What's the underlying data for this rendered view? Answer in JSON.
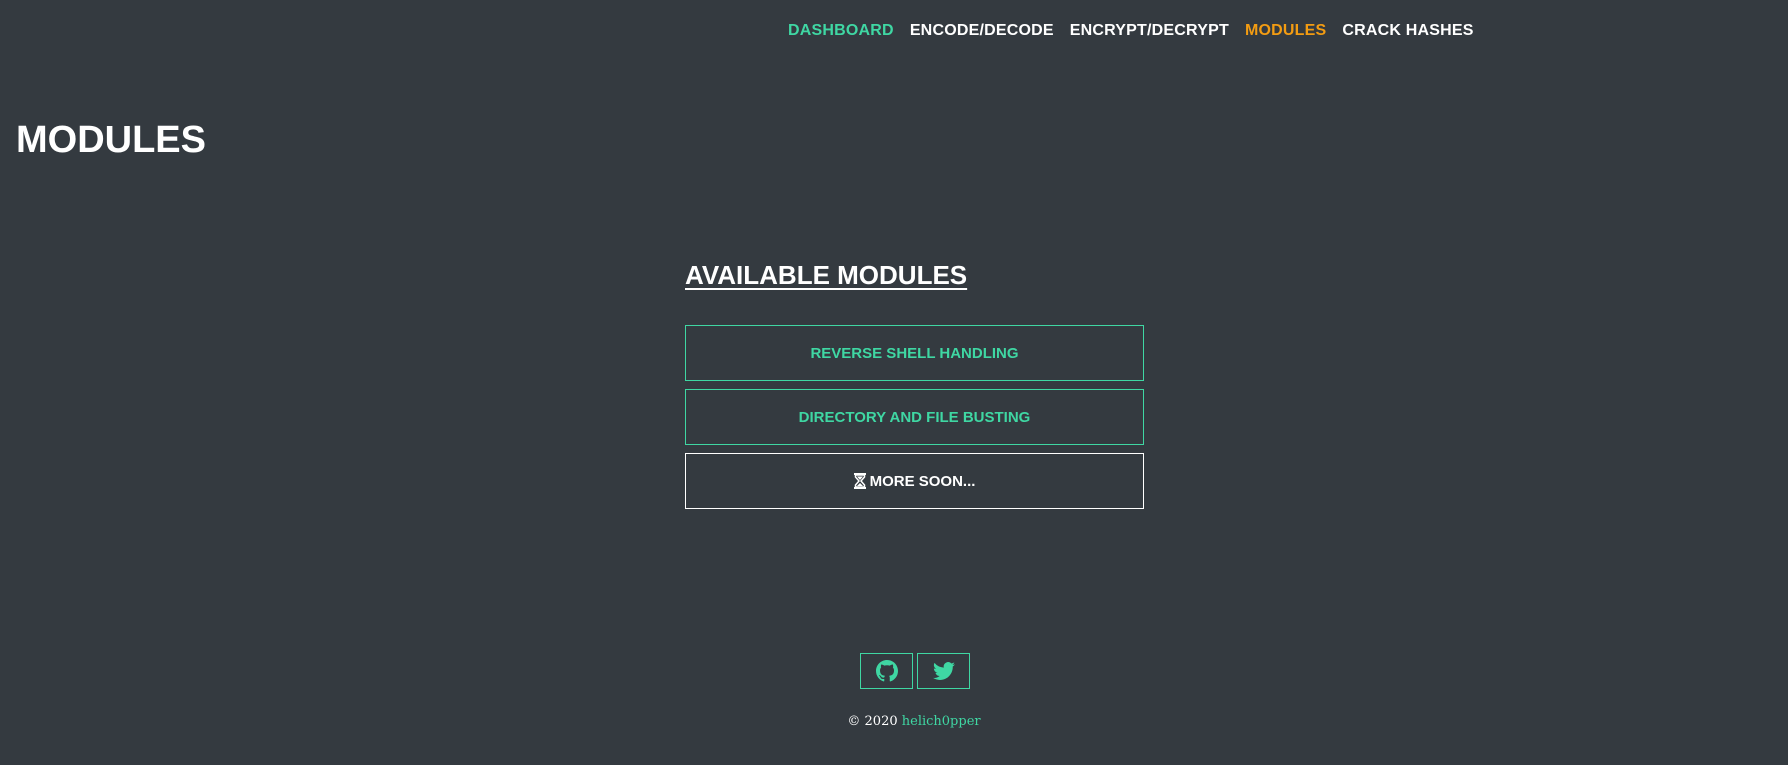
{
  "nav": {
    "items": [
      {
        "label": "DASHBOARD"
      },
      {
        "label": "ENCODE/DECODE"
      },
      {
        "label": "ENCRYPT/DECRYPT"
      },
      {
        "label": "MODULES"
      },
      {
        "label": "CRACK HASHES"
      }
    ],
    "active": "MODULES"
  },
  "page": {
    "title": "MODULES"
  },
  "modules": {
    "heading": "AVAILABLE MODULES",
    "items": [
      {
        "label": "REVERSE SHELL HANDLING"
      },
      {
        "label": "DIRECTORY AND FILE BUSTING"
      },
      {
        "label": "MORE SOON...",
        "icon": "hourglass-icon"
      }
    ]
  },
  "footer": {
    "social": [
      {
        "icon": "github-icon"
      },
      {
        "icon": "twitter-icon"
      }
    ],
    "copyright_prefix": "© 2020",
    "author": "helich0pper"
  },
  "colors": {
    "background": "#343a40",
    "accent": "#3fd7a3",
    "active": "#f39c12",
    "text": "#ffffff"
  }
}
